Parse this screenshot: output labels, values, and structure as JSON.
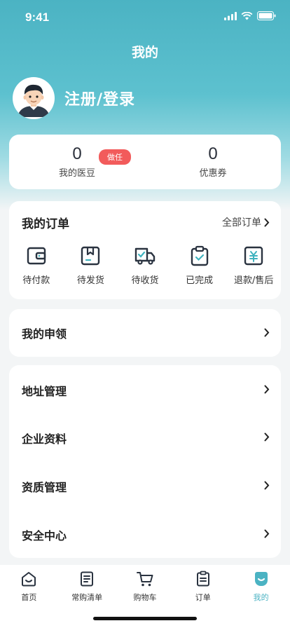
{
  "status": {
    "time": "9:41"
  },
  "header": {
    "title": "我的"
  },
  "profile": {
    "login_text": "注册/登录"
  },
  "stats": [
    {
      "value": "0",
      "label": "我的医豆",
      "badge": "做任"
    },
    {
      "value": "0",
      "label": "优惠券"
    }
  ],
  "orders": {
    "title": "我的订单",
    "all_label": "全部订单",
    "items": [
      {
        "label": "待付款",
        "icon": "wallet-icon"
      },
      {
        "label": "待发货",
        "icon": "package-icon"
      },
      {
        "label": "待收货",
        "icon": "truck-icon"
      },
      {
        "label": "已完成",
        "icon": "clipboard-check-icon"
      },
      {
        "label": "退款/售后",
        "icon": "refund-icon"
      }
    ]
  },
  "apply": {
    "title": "我的申领"
  },
  "menu": [
    {
      "label": "地址管理"
    },
    {
      "label": "企业资料"
    },
    {
      "label": "资质管理"
    },
    {
      "label": "安全中心"
    }
  ],
  "tabbar": [
    {
      "label": "首页",
      "icon": "home-icon"
    },
    {
      "label": "常购清单",
      "icon": "list-icon"
    },
    {
      "label": "购物车",
      "icon": "cart-icon"
    },
    {
      "label": "订单",
      "icon": "order-icon"
    },
    {
      "label": "我的",
      "icon": "profile-icon",
      "active": true
    }
  ],
  "colors": {
    "accent": "#4bb3c3",
    "badge": "#f25b5b"
  }
}
